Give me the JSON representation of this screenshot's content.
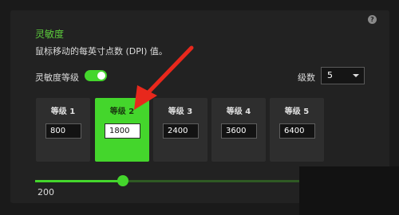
{
  "sensitivity": {
    "title": "灵敏度",
    "description": "鼠标移动的每英寸点数 (DPI) 值。",
    "stage_toggle_label": "灵敏度等级",
    "stage_toggle_on": true,
    "levels_label": "级数",
    "levels_value": "5",
    "stages": [
      {
        "label": "等级 1",
        "value": "800",
        "active": false
      },
      {
        "label": "等级 2",
        "value": "1800",
        "active": true
      },
      {
        "label": "等级 3",
        "value": "2400",
        "active": false
      },
      {
        "label": "等级 4",
        "value": "3600",
        "active": false
      },
      {
        "label": "等级 5",
        "value": "6400",
        "active": false
      }
    ],
    "slider": {
      "value": "200",
      "fill_fraction": 0.33
    }
  },
  "help_icon_glyph": "?",
  "colors": {
    "accent": "#44d62c",
    "title_green": "#5ccb3c",
    "annotation_arrow": "#e8281c"
  },
  "icons": [
    "help-icon",
    "chevron-down-icon",
    "annotation-arrow-icon"
  ]
}
